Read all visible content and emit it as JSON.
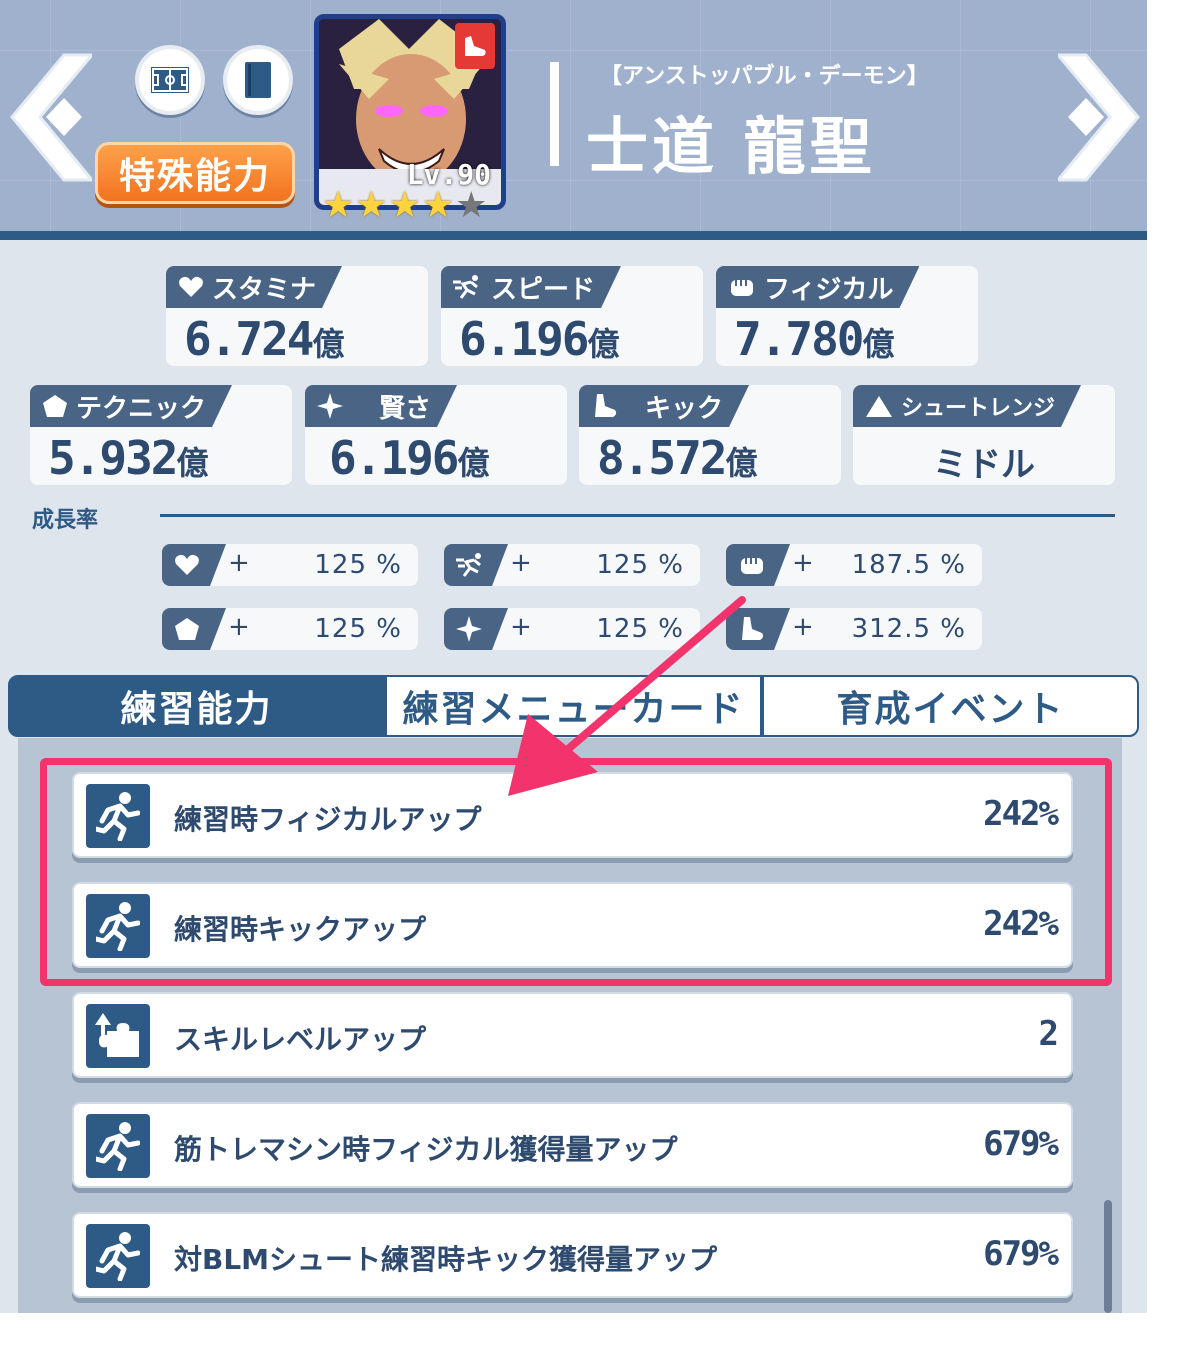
{
  "header": {
    "epithet": "【アンストッパブル・デーモン】",
    "name": "士道 龍聖",
    "special_button": "特殊能力",
    "level": "Lv.90",
    "stars_filled": 4,
    "stars_total": 5
  },
  "stats": [
    {
      "label": "スタミナ",
      "value": "6.724",
      "unit": "億",
      "icon": "heart-icon"
    },
    {
      "label": "スピード",
      "value": "6.196",
      "unit": "億",
      "icon": "sprint-icon"
    },
    {
      "label": "フィジカル",
      "value": "7.780",
      "unit": "億",
      "icon": "fist-icon"
    },
    {
      "label": "テクニック",
      "value": "5.932",
      "unit": "億",
      "icon": "pentagon-icon"
    },
    {
      "label": "賢さ",
      "value": "6.196",
      "unit": "億",
      "icon": "sparkle-icon"
    },
    {
      "label": "キック",
      "value": "8.572",
      "unit": "億",
      "icon": "shoe-icon"
    },
    {
      "label": "シュートレンジ",
      "value": "ミドル",
      "icon": "triangle-icon"
    }
  ],
  "growth": {
    "label": "成長率",
    "items": [
      {
        "icon": "heart-icon",
        "sign": "+",
        "value": "125 %"
      },
      {
        "icon": "sprint-icon",
        "sign": "+",
        "value": "125 %"
      },
      {
        "icon": "fist-icon",
        "sign": "+",
        "value": "187.5 %"
      },
      {
        "icon": "pentagon-icon",
        "sign": "+",
        "value": "125 %"
      },
      {
        "icon": "sparkle-icon",
        "sign": "+",
        "value": "125 %"
      },
      {
        "icon": "shoe-icon",
        "sign": "+",
        "value": "312.5 %"
      }
    ]
  },
  "tabs": [
    {
      "label": "練習能力",
      "active": true
    },
    {
      "label": "練習メニューカード",
      "active": false
    },
    {
      "label": "育成イベント",
      "active": false
    }
  ],
  "abilities": [
    {
      "label": "練習時フィジカルアップ",
      "value": "242%",
      "icon": "runner-icon"
    },
    {
      "label": "練習時キックアップ",
      "value": "242%",
      "icon": "runner-icon"
    },
    {
      "label": "スキルレベルアップ",
      "value": "2",
      "icon": "puzzle-up-icon"
    },
    {
      "label": "筋トレマシン時フィジカル獲得量アップ",
      "value": "679%",
      "icon": "runner-icon"
    },
    {
      "label": "対BLMシュート練習時キック獲得量アップ",
      "value": "679%",
      "icon": "runner-icon"
    }
  ],
  "colors": {
    "accent": "#2e5a86",
    "highlight": "#f2336c",
    "special": "#f2731f"
  }
}
